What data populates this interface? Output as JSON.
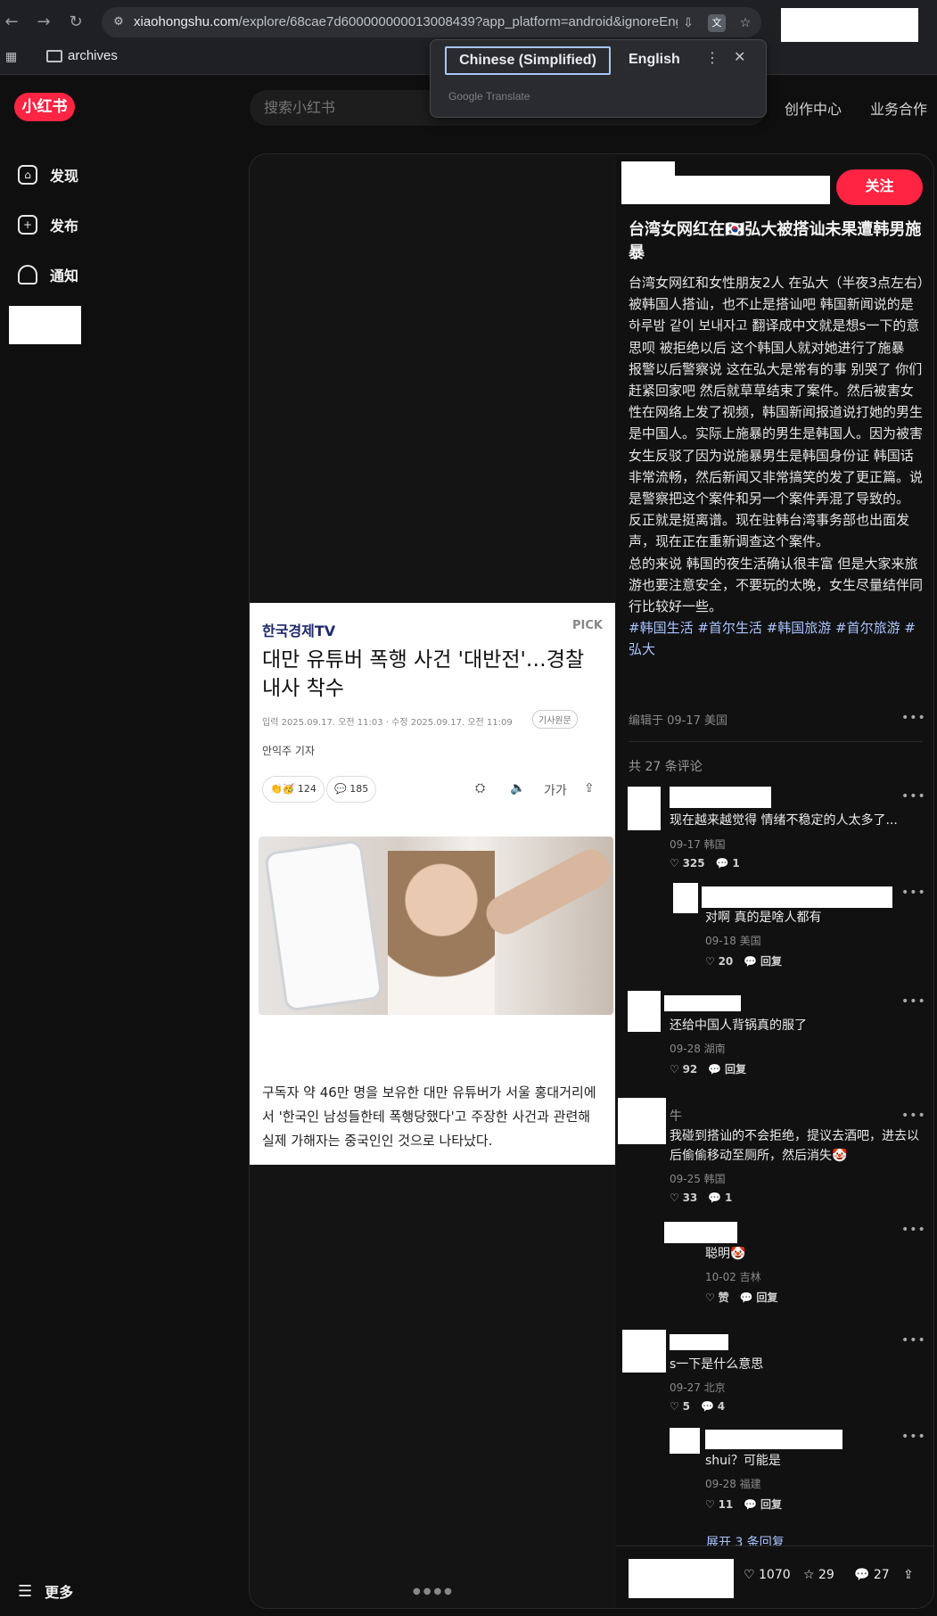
{
  "browser": {
    "url_domain": "xiaohongshu.com",
    "url_rest": "/explore/68cae7d600000000013008439?app_platform=android&ignoreEnga...",
    "bookmark_folder": "archives",
    "translate": {
      "lang_from": "Chinese (Simplified)",
      "lang_to": "English",
      "brand": "Google Translate"
    }
  },
  "app": {
    "logo": "小红书",
    "nav": [
      {
        "label": "发现",
        "icon": "home-icon"
      },
      {
        "label": "发布",
        "icon": "plus-icon"
      },
      {
        "label": "通知",
        "icon": "bell-icon"
      }
    ],
    "more_label": "更多",
    "search_placeholder": "搜索小红书",
    "top_links": [
      "创作中心",
      "业务合作"
    ]
  },
  "article": {
    "source": "한국경제TV",
    "pick": "PICK",
    "title": "대만 유튜버 폭행 사건 '대반전'…경찰 내사 착수",
    "meta": "입력 2025.09.17. 오전 11:03 · 수정 2025.09.17. 오전 11:09",
    "badge": "기사원문",
    "author": "안익주 기자",
    "likes": "124",
    "comments": "185",
    "font_tool": "가가",
    "body": "구독자 약 46만 명을 보유한 대만 유튜버가 서울 홍대거리에서 '한국인 남성들한테 폭행당했다'고 주장한 사건과 관련해 실제 가해자는 중국인인 것으로 나타났다."
  },
  "post": {
    "follow_label": "关注",
    "title": "台湾女网红在🇰🇷弘大被搭讪未果遭韩男施暴",
    "paragraphs": [
      "台湾女网红和女性朋友2人 在弘大（半夜3点左右）被韩国人搭讪，也不止是搭讪吧 韩国新闻说的是 하루밤 같이 보내자고 翻译成中文就是想s一下的意思呗 被拒绝以后 这个韩国人就对她进行了施暴",
      "报警以后警察说 这在弘大是常有的事 别哭了 你们赶紧回家吧 然后就草草结束了案件。然后被害女性在网络上发了视频，韩国新闻报道说打她的男生是中国人。实际上施暴的男生是韩国人。因为被害女生反驳了因为说施暴男生是韩国身份证 韩国话非常流畅，然后新闻又非常搞笑的发了更正篇。说是警察把这个案件和另一个案件弄混了导致的。",
      "反正就是挺离谱。现在驻韩台湾事务部也出面发声，现在正在重新调查这个案件。",
      "总的来说 韩国的夜生活确认很丰富 但是大家来旅游也要注意安全，不要玩的太晚，女生尽量结伴同行比较好一些。"
    ],
    "tags": "#韩国生活 #首尔生活 #韩国旅游 #首尔旅游 #弘大",
    "edited": "编辑于 09-17 美国",
    "comment_count": "共 27 条评论"
  },
  "comments": [
    {
      "name": "",
      "text": "现在越来越觉得 情绪不稳定的人太多了...",
      "meta": "09-17 韩国",
      "likes": "325",
      "replies": "1"
    },
    {
      "name": "",
      "text": "对啊 真的是啥人都有",
      "meta": "09-18 美国",
      "likes": "20",
      "reply_label": "回复"
    },
    {
      "name": "",
      "text": "还给中国人背锅真的服了",
      "meta": "09-28 湖南",
      "likes": "92",
      "reply_label": "回复"
    },
    {
      "name": "牛",
      "text": "我碰到搭讪的不会拒绝，提议去酒吧，进去以后偷偷移动至厕所，然后消失🤡",
      "meta": "09-25 韩国",
      "likes": "33",
      "replies": "1"
    },
    {
      "name": "",
      "text": "聪明🤡",
      "meta": "10-02 吉林",
      "likes": "赞",
      "reply_label": "回复"
    },
    {
      "name": "",
      "text": "s一下是什么意思",
      "meta": "09-27 北京",
      "likes": "5",
      "replies": "4"
    },
    {
      "name": "",
      "text": "shui？可能是",
      "meta": "09-28 福建",
      "likes": "11",
      "reply_label": "回复"
    }
  ],
  "expand_label": "展开 3 条回复",
  "bottom": {
    "likes": "1070",
    "stars": "29",
    "comments": "27"
  },
  "colors": {
    "accent": "#ff2442",
    "tag": "#a9c4ff",
    "bg": "#0f0f0f"
  }
}
